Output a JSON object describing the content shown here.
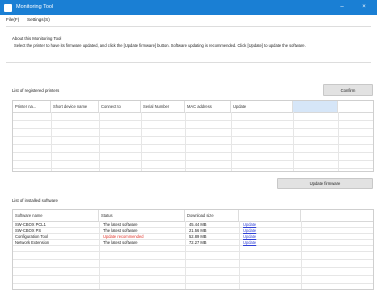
{
  "window": {
    "title": "Monitoring Tool",
    "minimize_glyph": "–",
    "close_glyph": "×"
  },
  "menu": {
    "items": [
      {
        "label": "File(F)"
      },
      {
        "label": "Settings(S)"
      }
    ]
  },
  "about": {
    "heading": "About this Monitoring Tool",
    "description": "Select the printer to have its firmware updated, and click the [Update firmware] button. Software updating is recommended. Click [Update] to update the software."
  },
  "printers": {
    "heading": "List of registered printers",
    "confirm_label": "Confirm",
    "columns": [
      "Printer na...",
      "Short device name",
      "Connect to",
      "Serial Number",
      "MAC address",
      "Update"
    ],
    "rows": [],
    "update_firmware_label": "Update firmware"
  },
  "software": {
    "heading": "List of installed software",
    "columns": [
      "Software name",
      "Status",
      "Download size",
      ""
    ],
    "rows": [
      {
        "name": "SW-CBOX PCL1",
        "status": "The latest software",
        "size": "45.44 MB",
        "action": "Update",
        "status_type": "ok"
      },
      {
        "name": "SW-CBOX PS",
        "status": "The latest software",
        "size": "21.56 MB",
        "action": "Update",
        "status_type": "ok"
      },
      {
        "name": "Configuration Tool",
        "status": "Update recommended",
        "size": "52.89 MB",
        "action": "Update",
        "status_type": "warn"
      },
      {
        "name": "Network Extension",
        "status": "The latest software",
        "size": "72.27 MB",
        "action": "Update",
        "status_type": "ok"
      }
    ]
  },
  "colors": {
    "titlebar": "#1a7fd4",
    "selected_cell": "#d6e6f8",
    "link": "#2f3fd6",
    "warning": "#e0342a"
  }
}
